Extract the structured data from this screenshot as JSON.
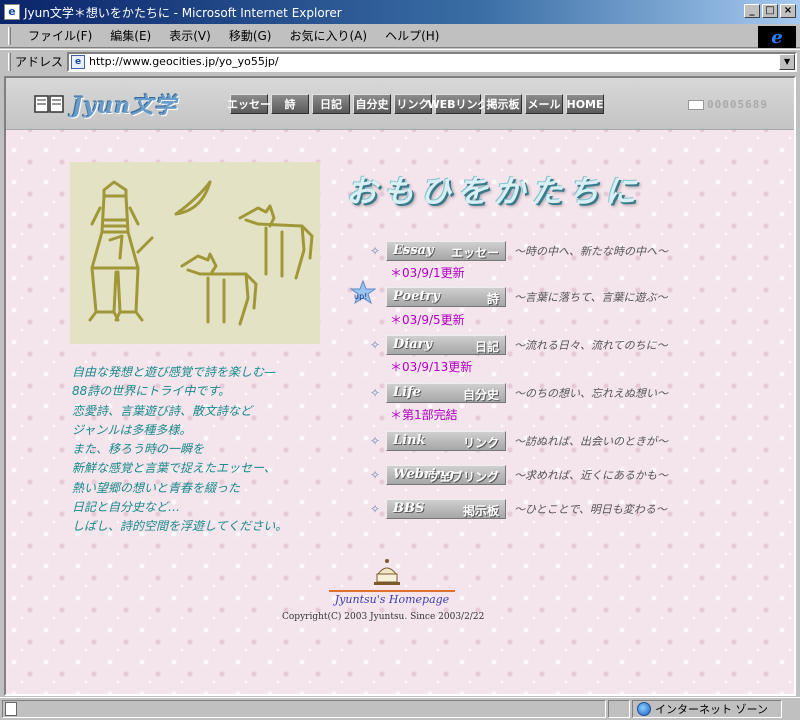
{
  "window": {
    "title": "Jyun文学＊想いをかたちに - Microsoft Internet Explorer",
    "app_icon": "ie-page-icon",
    "controls": [
      "_",
      "□",
      "×"
    ]
  },
  "menubar": {
    "items": [
      "ファイル(F)",
      "編集(E)",
      "表示(V)",
      "移動(G)",
      "お気に入り(A)",
      "ヘルプ(H)"
    ]
  },
  "addressbar": {
    "label": "アドレス",
    "url": "http://www.geocities.jp/yo_yo55jp/"
  },
  "site": {
    "logo_text": "Jyun文学",
    "nav": [
      "エッセー",
      "詩",
      "日記",
      "自分史",
      "リンク",
      "WEBリング",
      "掲示板",
      "メール",
      "HOME"
    ],
    "counter": "00005689",
    "heading": "おもひをかたちに",
    "intro_lines": [
      "自由な発想と遊び感覚で詩を楽しむ—",
      "88詩の世界にトライ中です。",
      "恋愛詩、言葉遊び詩、散文詩など",
      "ジャンルは多種多様。",
      "また、移ろう時の一瞬を",
      "新鮮な感覚と言葉で捉えたエッセー、",
      "熱い望郷の想いと青春を綴った",
      "日記と自分史など…",
      "しばし、詩的空間を浮遊してください。"
    ],
    "sections": [
      {
        "en": "Essay",
        "jp": "エッセー",
        "desc": "～時の中へ、新たな時の中へ～",
        "update": "＊03/9/1更新",
        "up_badge": ""
      },
      {
        "en": "Poetry",
        "jp": "詩",
        "desc": "～言葉に落ちて、言葉に遊ぶ～",
        "update": "＊03/9/5更新",
        "up_badge": "up!"
      },
      {
        "en": "Diary",
        "jp": "日記",
        "desc": "～流れる日々、流れてのちに～",
        "update": "＊03/9/13更新",
        "up_badge": ""
      },
      {
        "en": "Life",
        "jp": "自分史",
        "desc": "～のちの想い、忘れえぬ想い～",
        "update": "＊第1部完結",
        "up_badge": ""
      },
      {
        "en": "Link",
        "jp": "リンク",
        "desc": "～訪ぬれば、出会いのときが～",
        "update": "",
        "up_badge": ""
      },
      {
        "en": "Webring",
        "jp": "ウェブリング",
        "desc": "～求めれば、近くにあるかも～",
        "update": "",
        "up_badge": ""
      },
      {
        "en": "BBS",
        "jp": "掲示板",
        "desc": "～ひとことで、明日も変わる～",
        "update": "",
        "up_badge": ""
      }
    ],
    "footer_name": "Jyuntsu's Homepage",
    "copyright": "Copyright(C) 2003 Jyuntsu. Since 2003/2/22"
  },
  "statusbar": {
    "text": "",
    "zone": "インターネット ゾーン"
  },
  "colors": {
    "titlebar": "#0a246a",
    "page_bg": "#f4e4ec",
    "intro_text": "#1a8a8a",
    "update_text": "#b000c0",
    "heading": "#d8f0f4"
  }
}
